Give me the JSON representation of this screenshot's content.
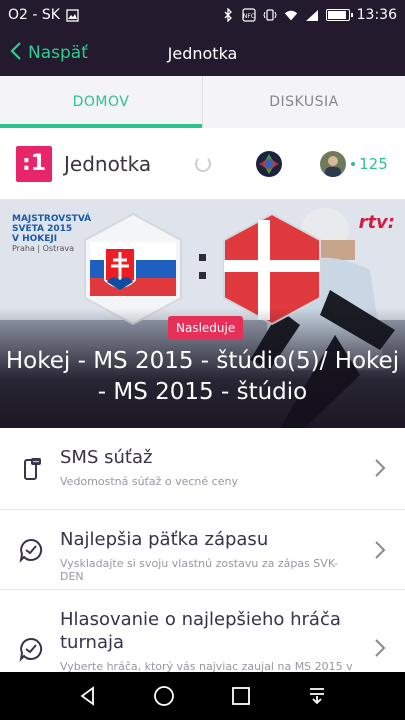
{
  "status_bar": {
    "carrier": "O2 - SK",
    "time": "13:36",
    "battery_level": 0.85
  },
  "app_bar": {
    "back_label": "Naspäť",
    "title": "Jednotka"
  },
  "tabs": [
    {
      "label": "DOMOV",
      "active": true
    },
    {
      "label": "DISKUSIA",
      "active": false
    }
  ],
  "channel": {
    "logo_text": ":1",
    "name": "Jednotka",
    "viewer_count": "125"
  },
  "hero": {
    "badge_line1": "MAJSTROVSTVÁ",
    "badge_line2": "SVETA 2015",
    "badge_line3": "V HOKEJI",
    "badge_line4": "Praha | Ostrava",
    "broadcaster": "rtv:",
    "status": "Nasleduje",
    "title": "Hokej - MS 2015 - štúdio(5)/ Hokej - MS 2015 - štúdio"
  },
  "items": [
    {
      "title": "SMS súťaž",
      "subtitle": "Vedomostná súťaž o vecné ceny",
      "icon": "phone-sms-icon"
    },
    {
      "title": "Najlepšia päťka zápasu",
      "subtitle": "Vyskladajte si svoju vlastnú zostavu za zápas SVK-DEN",
      "icon": "chat-check-icon"
    },
    {
      "title": "Hlasovanie o najlepšieho hráča turnaja",
      "subtitle": "Vyberte hráča, ktorý vás najviac zaujal na MS 2015 v",
      "icon": "chat-check-icon"
    }
  ],
  "colors": {
    "accent": "#2cc48c",
    "dark_bar": "#241a2e",
    "brand_pink": "#e8256b",
    "badge_red": "#e63057"
  }
}
